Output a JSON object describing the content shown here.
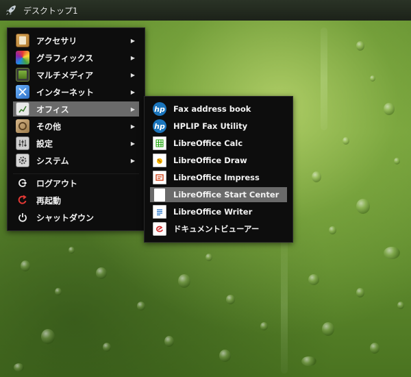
{
  "panel": {
    "desktop_label": "デスクトップ1"
  },
  "main_menu": {
    "items": [
      {
        "label": "アクセサリ",
        "icon": "accessories-icon",
        "has_submenu": true
      },
      {
        "label": "グラフィックス",
        "icon": "graphics-icon",
        "has_submenu": true
      },
      {
        "label": "マルチメディア",
        "icon": "multimedia-icon",
        "has_submenu": true
      },
      {
        "label": "インターネット",
        "icon": "internet-icon",
        "has_submenu": true
      },
      {
        "label": "オフィス",
        "icon": "office-icon",
        "has_submenu": true,
        "active": true
      },
      {
        "label": "その他",
        "icon": "other-icon",
        "has_submenu": true
      },
      {
        "label": "設定",
        "icon": "settings-icon",
        "has_submenu": true
      },
      {
        "label": "システム",
        "icon": "system-icon",
        "has_submenu": true
      }
    ],
    "actions": [
      {
        "label": "ログアウト",
        "icon": "logout-icon"
      },
      {
        "label": "再起動",
        "icon": "reboot-icon"
      },
      {
        "label": "シャットダウン",
        "icon": "shutdown-icon"
      }
    ],
    "submenu_arrow": "▶"
  },
  "office_menu": {
    "items": [
      {
        "label": "Fax address book",
        "icon": "hp-icon"
      },
      {
        "label": "HPLIP Fax Utility",
        "icon": "hp-icon"
      },
      {
        "label": "LibreOffice Calc",
        "icon": "calc-icon"
      },
      {
        "label": "LibreOffice Draw",
        "icon": "draw-icon"
      },
      {
        "label": "LibreOffice Impress",
        "icon": "impress-icon"
      },
      {
        "label": "LibreOffice Start Center",
        "icon": "document-icon",
        "active": true
      },
      {
        "label": "LibreOffice Writer",
        "icon": "writer-icon"
      },
      {
        "label": "ドキュメントビューアー",
        "icon": "document-viewer-icon"
      }
    ]
  },
  "colors": {
    "menu_bg": "#0d0d0d",
    "highlight": "#6a6a6a",
    "panel_bg": "#1c2219",
    "wallpaper": "#6f9c37"
  }
}
